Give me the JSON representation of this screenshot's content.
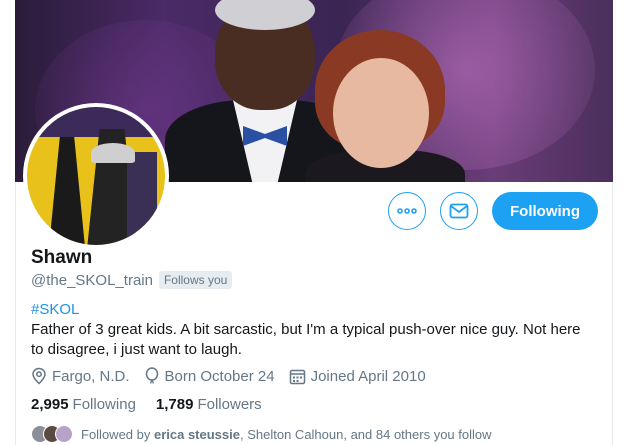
{
  "profile": {
    "name": "Shawn",
    "handle": "@the_SKOL_train",
    "follows_you": "Follows you",
    "hashtag": "#SKOL",
    "bio": "Father of 3 great kids. A bit sarcastic, but I'm a typical push-over nice guy.  Not here to disagree, i just want to laugh.",
    "location": "Fargo, N.D.",
    "birthday": "Born October 24",
    "joined": "Joined April 2010",
    "following_count": "2,995",
    "following_label": "Following",
    "followers_count": "1,789",
    "followers_label": "Followers"
  },
  "actions": {
    "more_icon": "more-dots-icon",
    "message_icon": "envelope-icon",
    "follow_label": "Following"
  },
  "followed_by": {
    "prefix": "Followed by ",
    "user1": "erica steussie",
    "rest": ", Shelton Calhoun, and 84 others you follow"
  },
  "colors": {
    "accent": "#1da1f2",
    "link": "#1b95e0",
    "secondary_text": "#657786"
  }
}
